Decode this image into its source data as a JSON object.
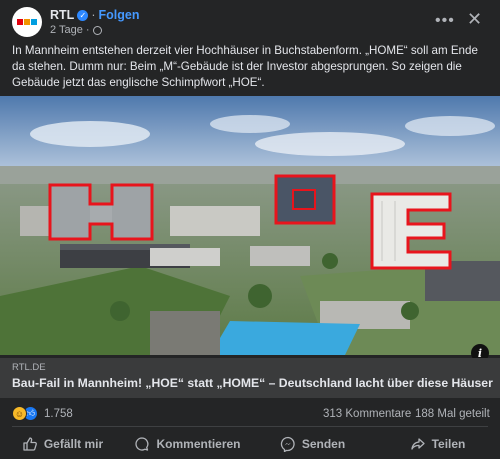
{
  "post": {
    "page_name": "RTL",
    "separator": "·",
    "follow_label": "Folgen",
    "time": "2 Tage",
    "time_separator": "·",
    "text": "In Mannheim entstehen derzeit vier Hochhäuser in Buchstabenform. „HOME“ soll am Ende da stehen. Dumm nur: Beim „M“-Gebäude ist der Investor abgesprungen. So zeigen die Gebäude jetzt das englische Schimpfwort „HOE“."
  },
  "image": {
    "letters": [
      "H",
      "O",
      "E"
    ],
    "info_label": "i"
  },
  "link": {
    "domain": "RTL.DE",
    "title": "Bau-Fail in Mannheim! „HOE“ statt „HOME“ – Deutschland lacht über diese Häuser"
  },
  "stats": {
    "reactions": "1.758",
    "comments": "313 Kommentare",
    "shares": "188 Mal geteilt"
  },
  "actions": {
    "like": "Gefällt mir",
    "comment": "Kommentieren",
    "send": "Senden",
    "share": "Teilen"
  },
  "icons": {
    "avatar": "rtl-logo",
    "verified": "verified-badge-icon",
    "audience": "globe-icon",
    "more": "more-icon",
    "close": "close-icon"
  },
  "colors": {
    "background": "#242526",
    "accent": "#4599ff",
    "text": "#e4e6eb",
    "muted": "#b0b3b8",
    "highlight_outline": "#e8141c"
  }
}
